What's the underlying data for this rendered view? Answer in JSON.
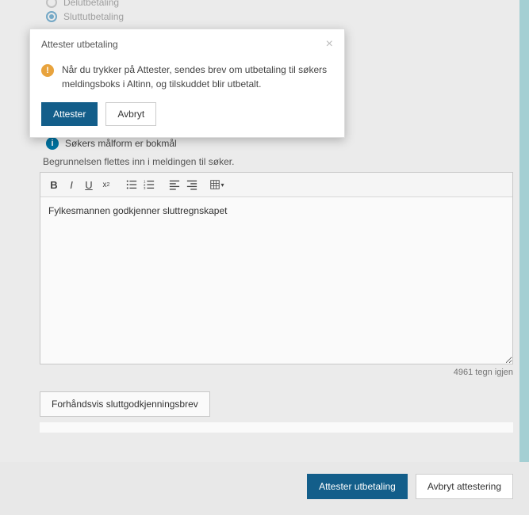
{
  "radios": {
    "option1": "Delutbetaling",
    "option2": "Sluttutbetaling"
  },
  "modal": {
    "title": "Attester utbetaling",
    "body": "Når du trykker på Attester, sendes brev om utbetaling til søkers meldingsboks i Altinn, og tilskuddet blir utbetalt.",
    "confirm": "Attester",
    "cancel": "Avbryt"
  },
  "info_language": "Søkers målform er bokmål",
  "help_text": "Begrunnelsen flettes inn i meldingen til søker.",
  "editor_content": "Fylkesmannen godkjenner sluttregnskapet",
  "char_count": "4961 tegn igjen",
  "preview_button": "Forhåndsvis sluttgodkjenningsbrev",
  "action_primary": "Attester utbetaling",
  "action_secondary": "Avbryt attestering"
}
